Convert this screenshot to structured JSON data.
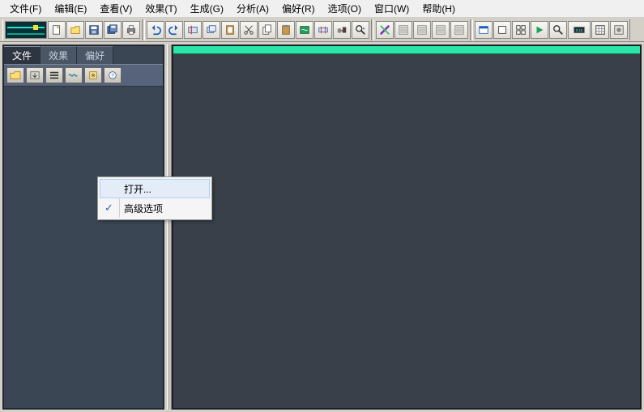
{
  "menubar": {
    "items": [
      {
        "label": "文件(F)"
      },
      {
        "label": "编辑(E)"
      },
      {
        "label": "查看(V)"
      },
      {
        "label": "效果(T)"
      },
      {
        "label": "生成(G)"
      },
      {
        "label": "分析(A)"
      },
      {
        "label": "偏好(R)"
      },
      {
        "label": "选项(O)"
      },
      {
        "label": "窗口(W)"
      },
      {
        "label": "帮助(H)"
      }
    ]
  },
  "toolbar": {
    "groups": [
      {
        "name": "file-group",
        "buttons": [
          "wave-preview",
          "new",
          "open",
          "save",
          "save-all",
          "print"
        ]
      },
      {
        "name": "edit-group",
        "buttons": [
          "undo",
          "redo",
          "cut2",
          "copy2",
          "paste2",
          "cut",
          "copy",
          "paste",
          "mix",
          "trim",
          "convert",
          "zoom-sel"
        ]
      },
      {
        "name": "analyze-group",
        "buttons": [
          "spectrum",
          "opt1",
          "opt2",
          "opt3",
          "opt4"
        ]
      },
      {
        "name": "view-group",
        "buttons": [
          "window-list",
          "window-cascade",
          "window-tile",
          "play",
          "find",
          "time-display",
          "grid",
          "settings"
        ]
      }
    ]
  },
  "sidebar": {
    "tabs": [
      {
        "label": "文件",
        "active": true
      },
      {
        "label": "效果",
        "active": false
      },
      {
        "label": "偏好",
        "active": false
      }
    ],
    "buttons": [
      "open-folder",
      "import",
      "list",
      "wave",
      "filter",
      "help"
    ]
  },
  "context_menu": {
    "items": [
      {
        "label": "打开...",
        "hover": true,
        "checked": false
      },
      {
        "label": "高级选项",
        "hover": false,
        "checked": true
      }
    ]
  },
  "colors": {
    "panel_bg": "#3b4654",
    "workspace_bg": "#394049",
    "green_bar": "#2be6a8"
  }
}
